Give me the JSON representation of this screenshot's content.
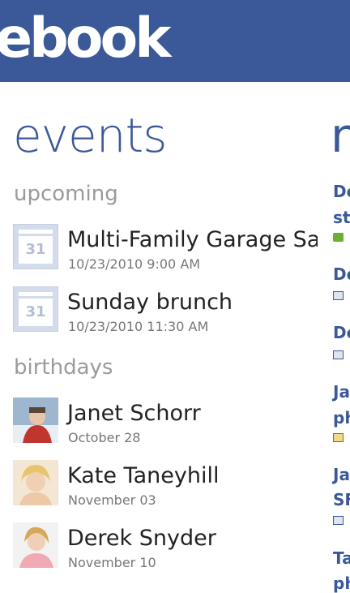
{
  "header": {
    "logo_text": "ebook"
  },
  "panel": {
    "title": "events",
    "next_panel_peek": "n"
  },
  "upcoming": {
    "label": "upcoming",
    "items": [
      {
        "title": "Multi-Family Garage Sale",
        "datetime": "10/23/2010 9:00 AM",
        "icon": "calendar-icon",
        "icon_text": "31"
      },
      {
        "title": "Sunday brunch",
        "datetime": "10/23/2010 11:30 AM",
        "icon": "calendar-icon",
        "icon_text": "31"
      }
    ]
  },
  "birthdays": {
    "label": "birthdays",
    "items": [
      {
        "name": "Janet Schorr",
        "date": "October 28"
      },
      {
        "name": "Kate Taneyhill",
        "date": "November 03"
      },
      {
        "name": "Derek Snyder",
        "date": "November 10"
      }
    ]
  },
  "next_panel": {
    "items": [
      "De",
      "sta",
      "De",
      "De",
      "Ja",
      "ph",
      "Ja",
      "SF",
      "Ta",
      "ph"
    ],
    "icons": [
      "chat-icon",
      "like-icon",
      "like-icon",
      "photo-icon",
      "like-icon"
    ]
  },
  "colors": {
    "brand": "#3b5998",
    "section": "#9a9a9a",
    "secondary": "#777777"
  }
}
